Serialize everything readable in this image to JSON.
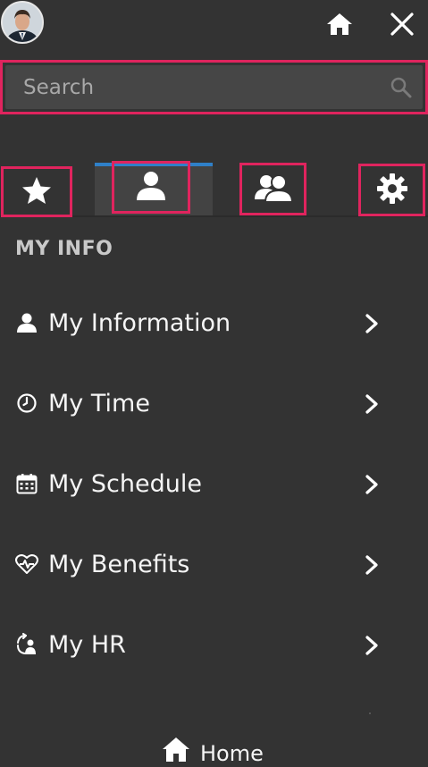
{
  "header": {
    "avatar_alt": "User profile photo",
    "home_icon": "home-icon",
    "close_icon": "close-icon"
  },
  "search": {
    "placeholder": "Search",
    "value": ""
  },
  "tabs": [
    {
      "icon": "star-icon",
      "active": false
    },
    {
      "icon": "person-icon",
      "active": true
    },
    {
      "icon": "people-icon",
      "active": false
    },
    {
      "icon": "gear-icon",
      "active": false
    }
  ],
  "section": {
    "title": "MY INFO"
  },
  "menu": {
    "items": [
      {
        "label": "My Information",
        "icon": "person-icon"
      },
      {
        "label": "My Time",
        "icon": "clock-icon"
      },
      {
        "label": "My Schedule",
        "icon": "calendar-icon"
      },
      {
        "label": "My Benefits",
        "icon": "heart-pulse-icon"
      },
      {
        "label": "My HR",
        "icon": "hr-cycle-icon"
      }
    ]
  },
  "footer": {
    "home_label": "Home"
  },
  "colors": {
    "background": "#333333",
    "highlight_border": "#e0245e",
    "active_tab_accent": "#2f80c8"
  }
}
